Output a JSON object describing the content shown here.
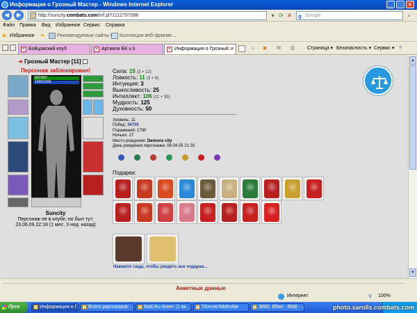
{
  "window": {
    "title": "Информация о Грозный Мастер - Windows Internet Explorer"
  },
  "address": {
    "prefix": "http://suncity.",
    "host": "combats.com",
    "path": "/inf.pl?1112797996",
    "search_placeholder": "Google"
  },
  "menu": [
    "Файл",
    "Правка",
    "Вид",
    "Избранное",
    "Сервис",
    "Справка"
  ],
  "favbar": {
    "favorites": "Избранное",
    "recommended": "Рекомендуемые сайты ▾",
    "gallery": "Коллекция веб-фрагме..."
  },
  "tabs": [
    {
      "label": "Бойцовский клуб",
      "active": false
    },
    {
      "label": "Артикли БК v.3",
      "active": false
    },
    {
      "label": "Информация о Грозный...",
      "active": true
    }
  ],
  "toolbar_right": {
    "page": "Страница ▾",
    "security": "Безопасность ▾",
    "tools": "Сервис ▾"
  },
  "character": {
    "name": "Грозный Мастер",
    "level": "[11]",
    "blocked": "Персонаж заблокирован!",
    "hp": "997/997",
    "mana": "1095/1095",
    "bottom_name": "Suncity",
    "status_line1": "Персонаж не в клубе, но был тут:",
    "status_line2": "23.06.09 22:18 (1 мес. 3 нед. назад)"
  },
  "stats": [
    {
      "label": "Сила:",
      "value": "15",
      "extra": "(3 + 12)",
      "green": true
    },
    {
      "label": "Ловкость:",
      "value": "11",
      "extra": "(3 + 8)",
      "green": true
    },
    {
      "label": "Интуиция:",
      "value": "3",
      "extra": "",
      "green": false
    },
    {
      "label": "Выносливость:",
      "value": "25",
      "extra": "",
      "green": false
    },
    {
      "label": "Интеллект:",
      "value": "106",
      "extra": "(11 + 95)",
      "green": true
    },
    {
      "label": "Мудрость:",
      "value": "125",
      "extra": "",
      "green": false
    },
    {
      "label": "Духовность:",
      "value": "50",
      "extra": "",
      "green": false
    }
  ],
  "info": {
    "level": "Уровень: 11",
    "wins_label": "Побед:",
    "wins": "26705",
    "losses": "Поражений: 1790",
    "draws": "Ничьих: 27",
    "birthplace_label": "Место рождения:",
    "birthplace": "Demons city",
    "birthday": "День рождения персонажа: 06.04.05 21:33"
  },
  "gifts_title": "Подарки:",
  "more_gifts_link": "Нажмите сюда, чтобы увидеть все подарки...",
  "section_title": "Анкетные данные",
  "status": {
    "zone": "Интернет",
    "zoom": "100%"
  },
  "taskbar": {
    "start": "Пуск",
    "tasks": [
      {
        "label": "Информация о Г...",
        "active": true
      },
      {
        "label": "Всего разговоров: ...",
        "active": false
      },
      {
        "label": "Mail.Ru Агент (1 вк...",
        "active": false
      },
      {
        "label": "\\\\Server\\Mahnilar",
        "active": false
      },
      {
        "label": "3880. Elton - Bitdi - ...",
        "active": false
      }
    ]
  },
  "watermark": "photo.sarolls.combats.com",
  "colors": {
    "blocked": "#d62020",
    "green_stat": "#0a8a0a",
    "link": "#1a3a9a",
    "section": "#a02020",
    "tab_pink": "#e7b2e0"
  }
}
